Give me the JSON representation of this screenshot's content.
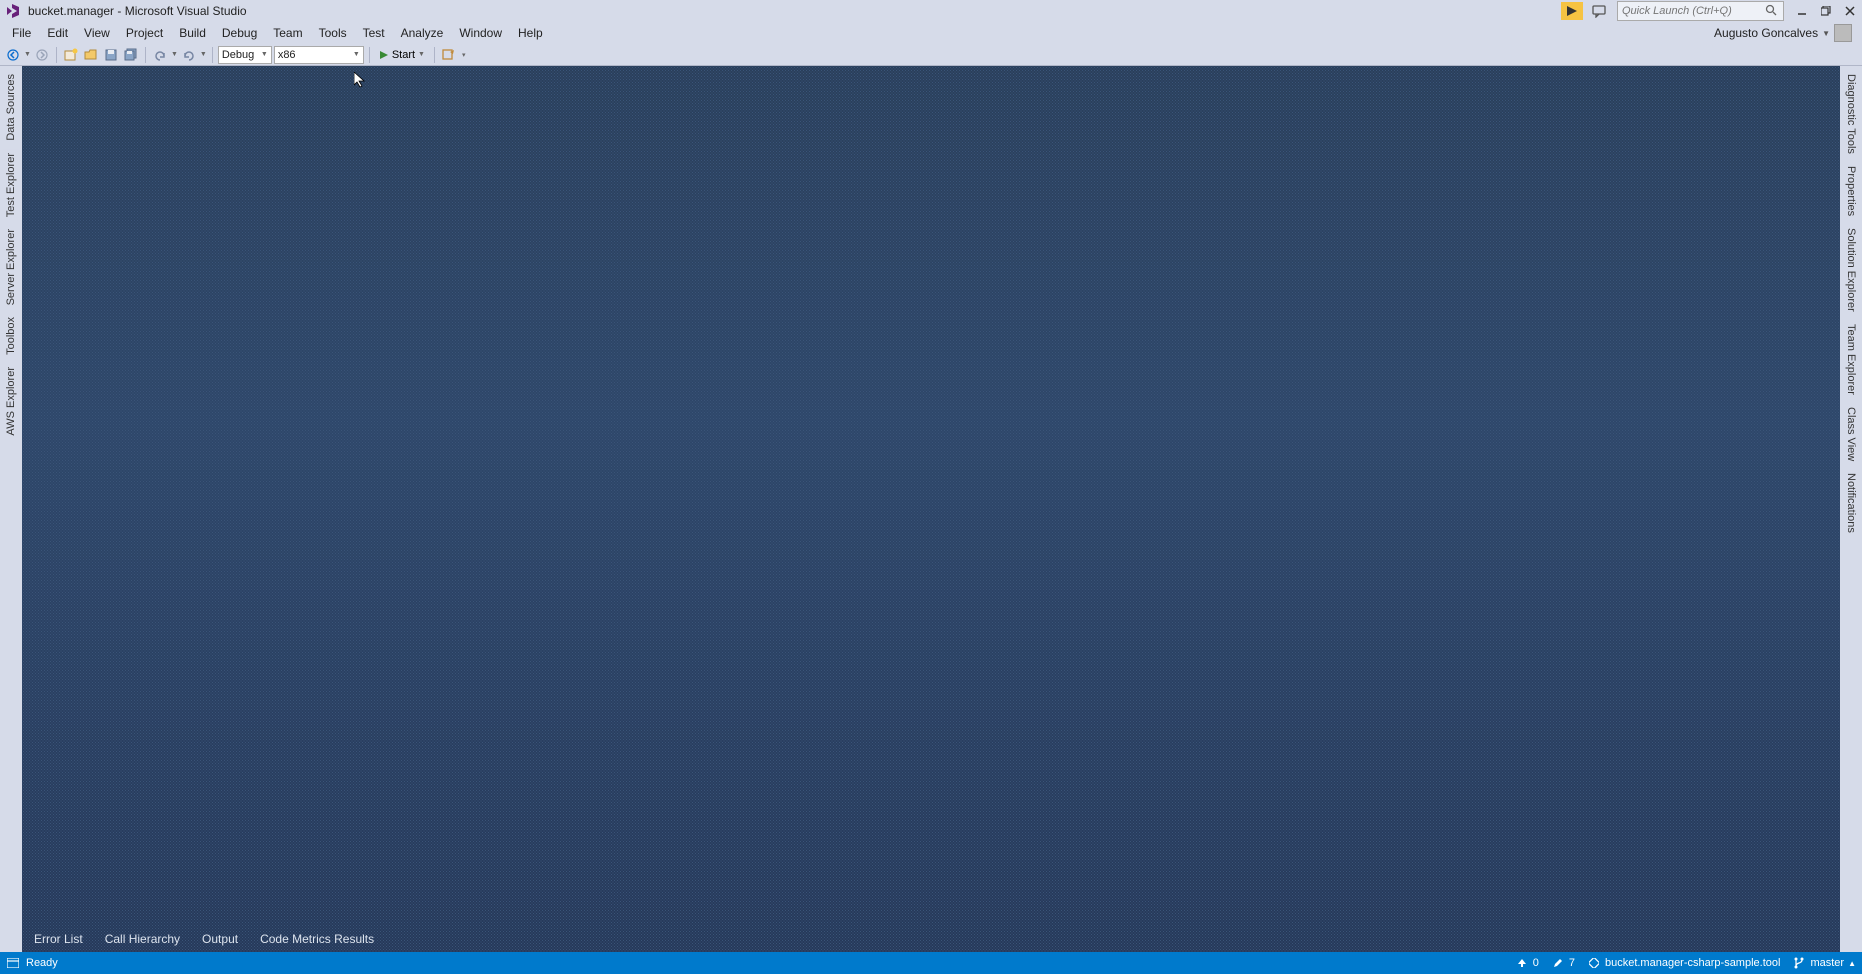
{
  "title": "bucket.manager - Microsoft Visual Studio",
  "quick_launch_placeholder": "Quick Launch (Ctrl+Q)",
  "user_name": "Augusto Goncalves",
  "menu": {
    "file": "File",
    "edit": "Edit",
    "view": "View",
    "project": "Project",
    "build": "Build",
    "debug": "Debug",
    "team": "Team",
    "tools": "Tools",
    "test": "Test",
    "analyze": "Analyze",
    "window": "Window",
    "help": "Help"
  },
  "toolbar": {
    "config": "Debug",
    "platform": "x86",
    "start": "Start"
  },
  "left_tabs": [
    "Data Sources",
    "Test Explorer",
    "Server Explorer",
    "Toolbox",
    "AWS Explorer"
  ],
  "right_tabs": [
    "Diagnostic Tools",
    "Properties",
    "Solution Explorer",
    "Team Explorer",
    "Class View",
    "Notifications"
  ],
  "bottom_tabs": [
    "Error List",
    "Call Hierarchy",
    "Output",
    "Code Metrics Results"
  ],
  "status": {
    "ready": "Ready",
    "up_count": "0",
    "pencil_count": "7",
    "project": "bucket.manager-csharp-sample.tool",
    "branch": "master"
  }
}
